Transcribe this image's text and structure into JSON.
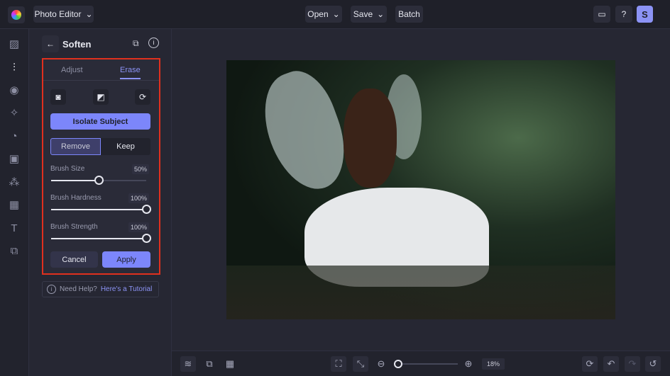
{
  "app": {
    "name": "Photo Editor"
  },
  "toolbar": {
    "open": "Open",
    "save": "Save",
    "batch": "Batch",
    "avatar": "S"
  },
  "panel": {
    "title": "Soften",
    "tabs": [
      "Adjust",
      "Erase"
    ],
    "active_tab": "Erase",
    "isolate": "Isolate Subject",
    "mode": [
      "Remove",
      "Keep"
    ],
    "active_mode": "Remove",
    "sliders": [
      {
        "label": "Brush Size",
        "value": "50%",
        "fraction": 0.5
      },
      {
        "label": "Brush Hardness",
        "value": "100%",
        "fraction": 1
      },
      {
        "label": "Brush Strength",
        "value": "100%",
        "fraction": 1
      }
    ],
    "cancel": "Cancel",
    "apply": "Apply",
    "help": "Need Help?",
    "help_link": "Here's a Tutorial"
  },
  "zoom": {
    "value": "18%",
    "fraction": 0.02
  },
  "colors": {
    "accent": "#7c86fb",
    "highlight": "#e0301e"
  }
}
